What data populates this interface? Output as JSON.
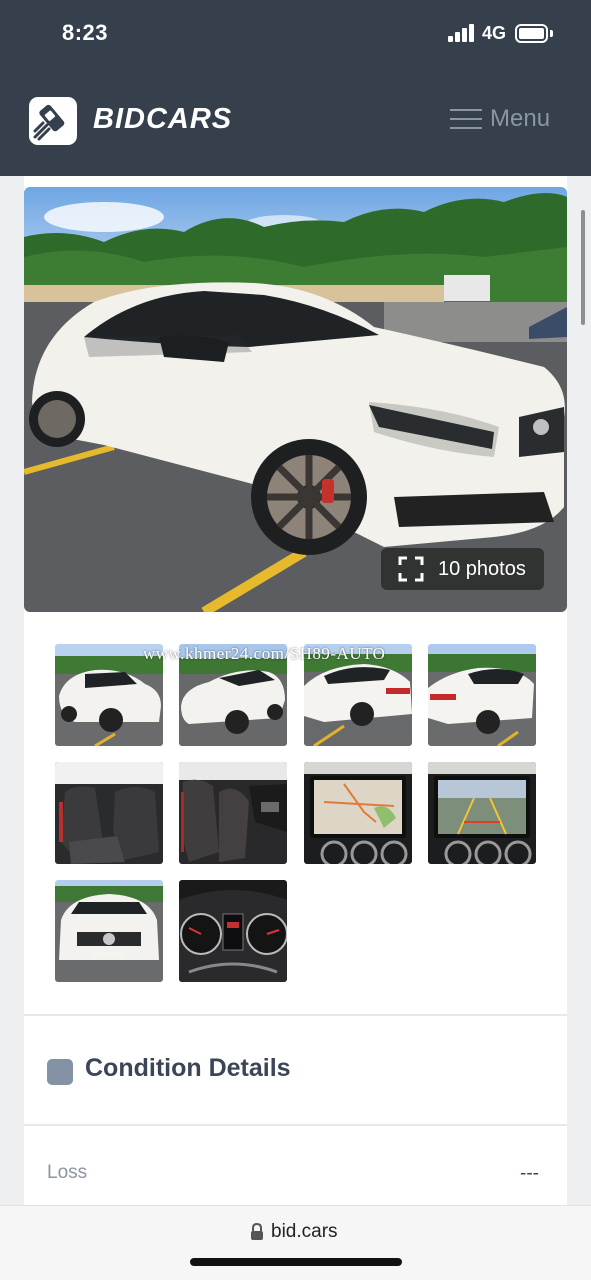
{
  "status_bar": {
    "time": "8:23",
    "network": "4G"
  },
  "header": {
    "brand": "BIDCARS",
    "menu_label": "Menu"
  },
  "gallery": {
    "photo_count_label": "10 photos",
    "watermark": "www.khmer24.com/SH89-AUTO",
    "thumbnails": [
      "front-left-exterior",
      "front-right-exterior",
      "rear-right-exterior",
      "rear-left-exterior",
      "rear-seats",
      "front-seats",
      "navigation-screen",
      "backup-camera-screen",
      "front-exterior",
      "instrument-cluster"
    ]
  },
  "condition": {
    "title": "Condition Details",
    "rows": [
      {
        "label": "Loss",
        "value": "---"
      }
    ]
  },
  "browser": {
    "url": "bid.cars"
  }
}
